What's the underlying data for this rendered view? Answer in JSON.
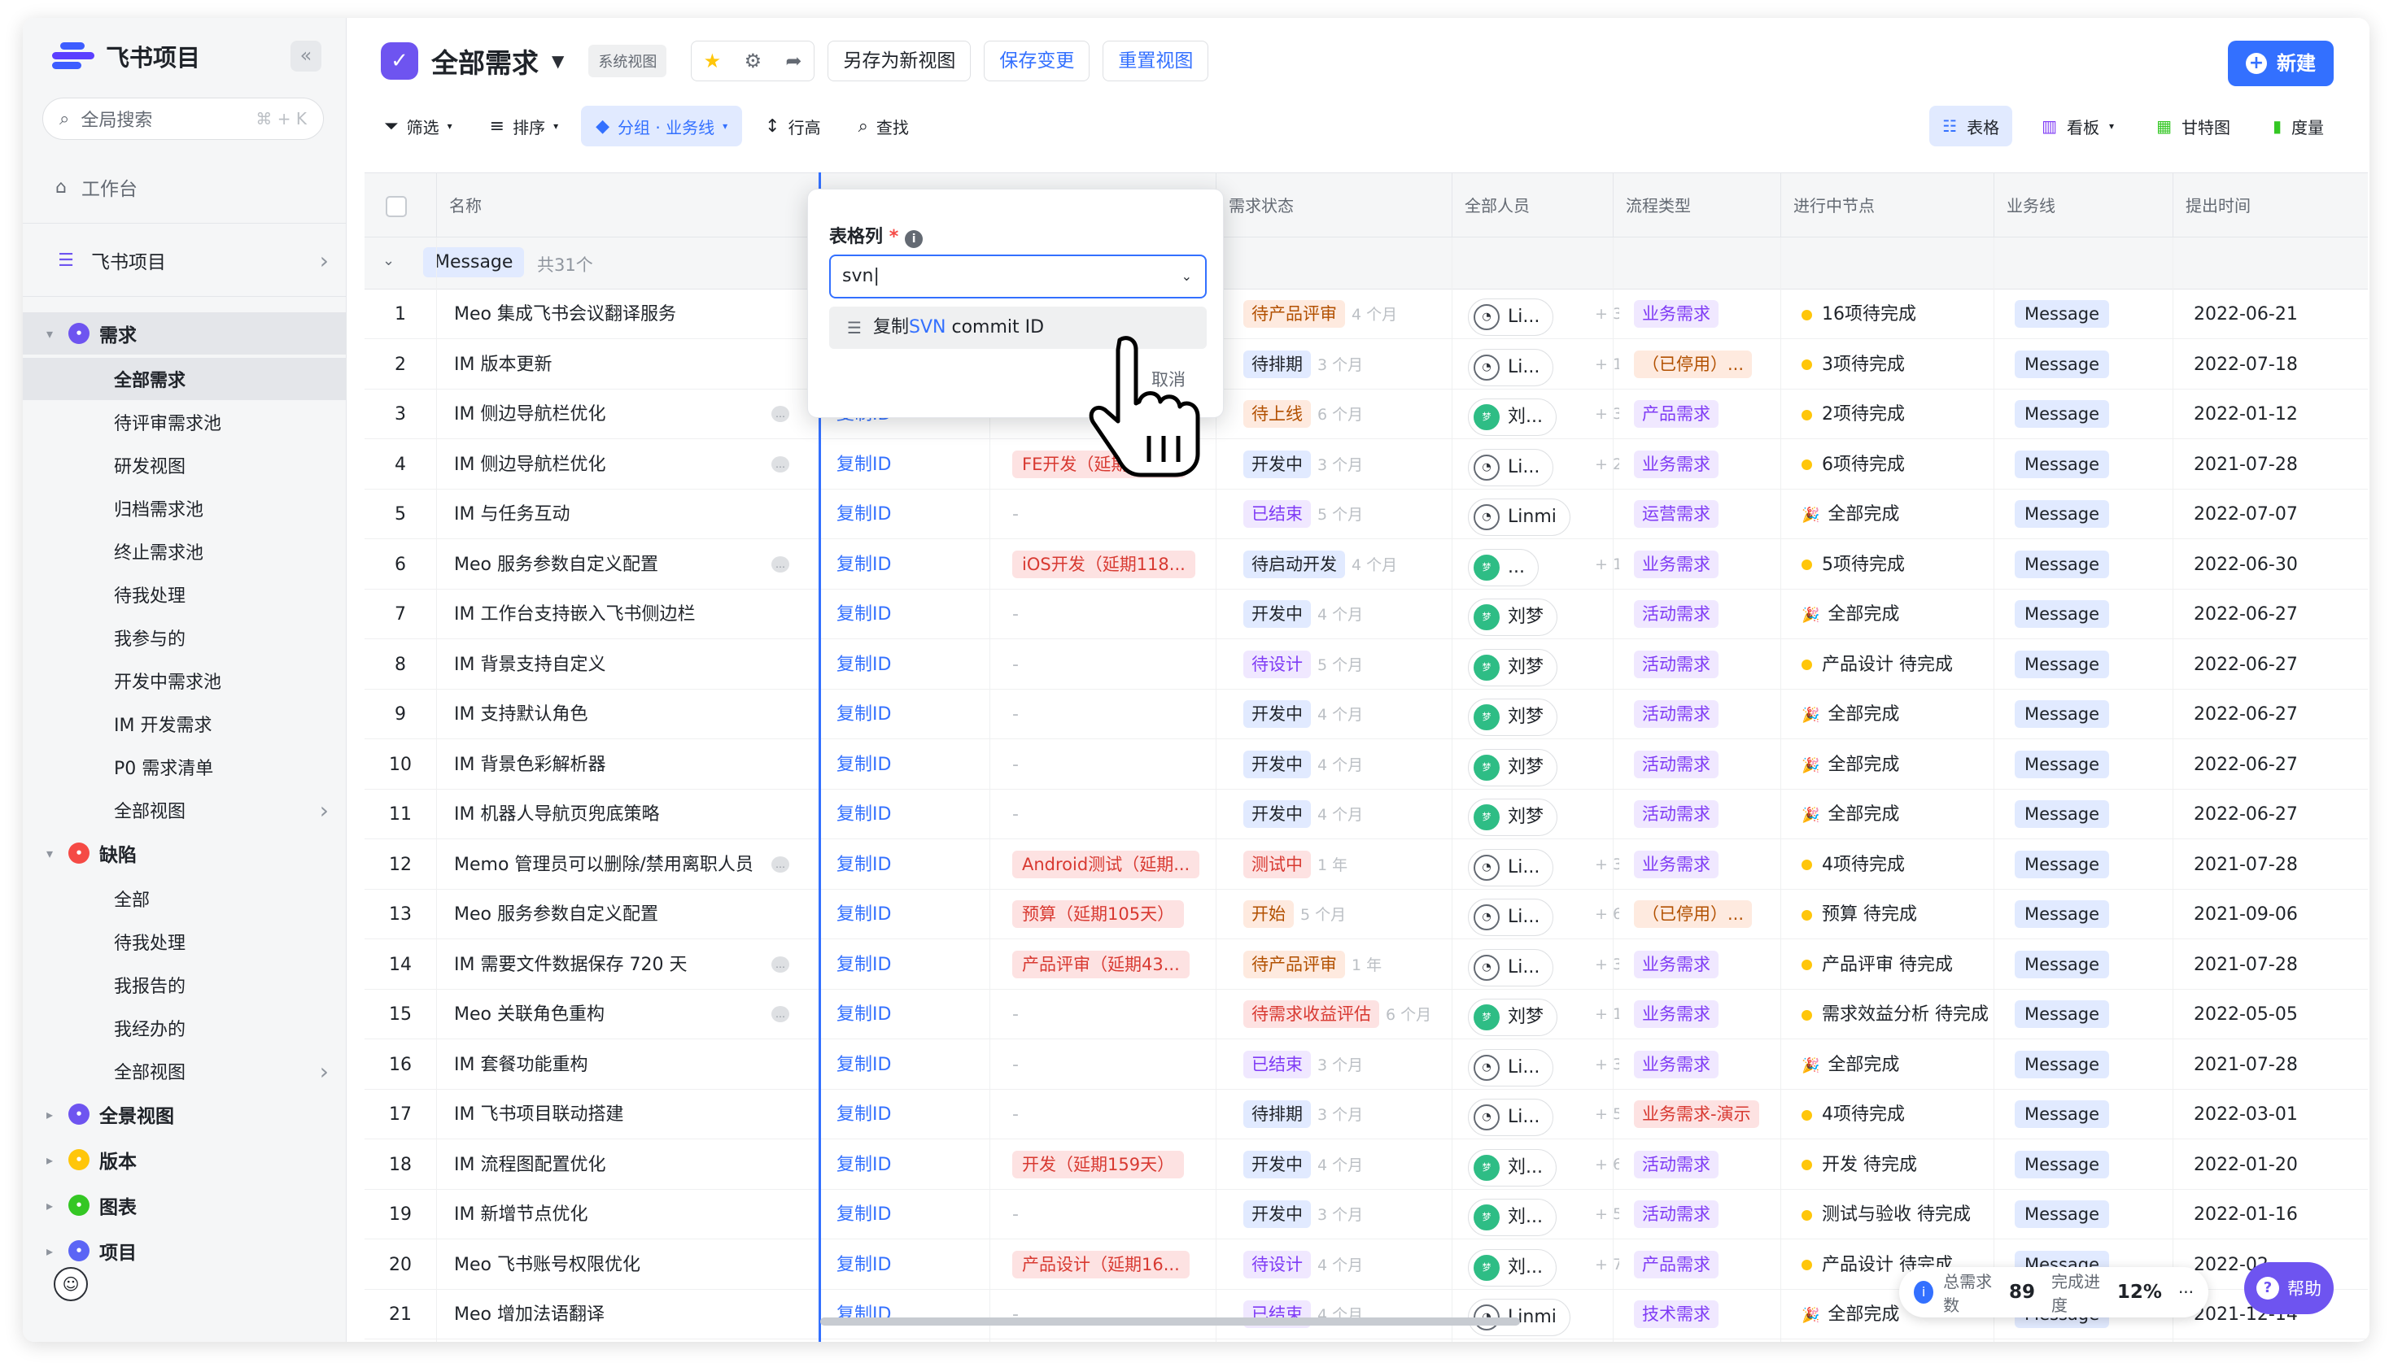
{
  "sidebar": {
    "app_name": "飞书项目",
    "search": {
      "label": "全局搜索",
      "shortcut": "⌘ + K"
    },
    "workbench": "工作台",
    "space": "飞书项目",
    "sections": [
      {
        "label": "需求",
        "color": "#6e54f0",
        "items": [
          "全部需求",
          "待评审需求池",
          "研发视图",
          "归档需求池",
          "终止需求池",
          "待我处理",
          "我参与的",
          "开发中需求池",
          "IM 开发需求",
          "P0 需求清单",
          "全部视图"
        ]
      },
      {
        "label": "缺陷",
        "color": "#f54a45",
        "items": [
          "全部",
          "待我处理",
          "我报告的",
          "我经办的",
          "全部视图"
        ]
      },
      {
        "label": "全景视图",
        "color": "#6e54f0"
      },
      {
        "label": "版本",
        "color": "#ffc60a"
      },
      {
        "label": "图表",
        "color": "#34c724"
      },
      {
        "label": "项目",
        "color": "#5b65f5"
      }
    ]
  },
  "header": {
    "title": "全部需求",
    "system_view": "系统视图",
    "save_as": "另存为新视图",
    "save_changes": "保存变更",
    "reset_view": "重置视图",
    "new_label": "新建"
  },
  "toolbar": {
    "filter": "筛选",
    "sort": "排序",
    "group": "分组 · 业务线",
    "row_height": "行高",
    "find": "查找"
  },
  "views": {
    "table": "表格",
    "kanban": "看板",
    "gantt": "甘特图",
    "metrics": "度量"
  },
  "columns": {
    "name": "名称",
    "status": "需求状态",
    "people": "全部人员",
    "flow": "流程类型",
    "node": "进行中节点",
    "biz": "业务线",
    "date": "提出时间"
  },
  "group": {
    "label": "Message",
    "count": "共31个"
  },
  "rows": [
    {
      "i": "1",
      "name": "Meo 集成飞书会议翻译服务",
      "copy": "",
      "blk": "",
      "status": "待产品评审",
      "ago": "4 个月",
      "person": "Li...",
      "more": "+ 3",
      "flow": "业务需求",
      "node": "16项待完成",
      "biz": "Message",
      "date": "2022-06-21"
    },
    {
      "i": "2",
      "name": "IM 版本更新",
      "copy": "",
      "blk": "",
      "status": "待排期",
      "ago": "3 个月",
      "person": "Li...",
      "more": "+ 1",
      "flow": "（已停用）...",
      "node": "3项待完成",
      "biz": "Message",
      "date": "2022-07-18"
    },
    {
      "i": "3",
      "name": "IM 侧边导航栏优化",
      "copy": "复制ID",
      "blk": "-",
      "status": "待上线",
      "ago": "6 个月",
      "person": "刘...",
      "more": "+ 3",
      "flow": "产品需求",
      "node": "2项待完成",
      "biz": "Message",
      "date": "2022-01-12"
    },
    {
      "i": "4",
      "name": "IM 侧边导航栏优化",
      "copy": "复制ID",
      "blk": "FE开发（延期496...",
      "status": "开发中",
      "ago": "3 个月",
      "person": "Li...",
      "more": "+ 2",
      "flow": "业务需求",
      "node": "6项待完成",
      "biz": "Message",
      "date": "2021-07-28"
    },
    {
      "i": "5",
      "name": "IM 与任务互动",
      "copy": "复制ID",
      "blk": "-",
      "status": "已结束",
      "ago": "5 个月",
      "person": "Linmi",
      "more": "",
      "flow": "运营需求",
      "node": "全部完成",
      "biz": "Message",
      "date": "2022-07-07"
    },
    {
      "i": "6",
      "name": "Meo 服务参数自定义配置",
      "copy": "复制ID",
      "blk": "iOS开发（延期118...",
      "status": "待启动开发",
      "ago": "4 个月",
      "person": "...",
      "more": "+ 10",
      "flow": "业务需求",
      "node": "5项待完成",
      "biz": "Message",
      "date": "2022-06-30"
    },
    {
      "i": "7",
      "name": "IM 工作台支持嵌入飞书侧边栏",
      "copy": "复制ID",
      "blk": "-",
      "status": "开发中",
      "ago": "4 个月",
      "person": "刘梦",
      "more": "",
      "flow": "活动需求",
      "node": "全部完成",
      "biz": "Message",
      "date": "2022-06-27"
    },
    {
      "i": "8",
      "name": "IM 背景支持自定义",
      "copy": "复制ID",
      "blk": "-",
      "status": "待设计",
      "ago": "5 个月",
      "person": "刘梦",
      "more": "",
      "flow": "活动需求",
      "node": "产品设计 待完成",
      "biz": "Message",
      "date": "2022-06-27"
    },
    {
      "i": "9",
      "name": "IM 支持默认角色",
      "copy": "复制ID",
      "blk": "-",
      "status": "开发中",
      "ago": "4 个月",
      "person": "刘梦",
      "more": "",
      "flow": "活动需求",
      "node": "全部完成",
      "biz": "Message",
      "date": "2022-06-27"
    },
    {
      "i": "10",
      "name": "IM 背景色彩解析器",
      "copy": "复制ID",
      "blk": "-",
      "status": "开发中",
      "ago": "4 个月",
      "person": "刘梦",
      "more": "",
      "flow": "活动需求",
      "node": "全部完成",
      "biz": "Message",
      "date": "2022-06-27"
    },
    {
      "i": "11",
      "name": "IM 机器人导航页兜底策略",
      "copy": "复制ID",
      "blk": "-",
      "status": "开发中",
      "ago": "4 个月",
      "person": "刘梦",
      "more": "",
      "flow": "活动需求",
      "node": "全部完成",
      "biz": "Message",
      "date": "2022-06-27"
    },
    {
      "i": "12",
      "name": "Memo 管理员可以删除/禁用离职人员",
      "copy": "复制ID",
      "blk": "Android测试（延期...",
      "status": "测试中",
      "ago": "1 年",
      "person": "Li...",
      "more": "+ 3",
      "flow": "业务需求",
      "node": "4项待完成",
      "biz": "Message",
      "date": "2021-07-28"
    },
    {
      "i": "13",
      "name": "Meo 服务参数自定义配置",
      "copy": "复制ID",
      "blk": "预算（延期105天）",
      "status": "开始",
      "ago": "5 个月",
      "person": "Li...",
      "more": "+ 6",
      "flow": "（已停用）...",
      "node": "预算 待完成",
      "biz": "Message",
      "date": "2021-09-06"
    },
    {
      "i": "14",
      "name": "IM 需要文件数据保存 720 天",
      "copy": "复制ID",
      "blk": "产品评审（延期43...",
      "status": "待产品评审",
      "ago": "1 年",
      "person": "Li...",
      "more": "+ 3",
      "flow": "业务需求",
      "node": "产品评审 待完成",
      "biz": "Message",
      "date": "2021-07-28"
    },
    {
      "i": "15",
      "name": "Meo 关联角色重构",
      "copy": "复制ID",
      "blk": "-",
      "status": "待需求收益评估",
      "ago": "6 个月",
      "person": "刘梦",
      "more": "+ 1",
      "flow": "业务需求",
      "node": "需求效益分析 待完成",
      "biz": "Message",
      "date": "2022-05-05"
    },
    {
      "i": "16",
      "name": "IM 套餐功能重构",
      "copy": "复制ID",
      "blk": "-",
      "status": "已结束",
      "ago": "3 个月",
      "person": "Li...",
      "more": "+ 3",
      "flow": "业务需求",
      "node": "全部完成",
      "biz": "Message",
      "date": "2021-07-28"
    },
    {
      "i": "17",
      "name": "IM 飞书项目联动搭建",
      "copy": "复制ID",
      "blk": "-",
      "status": "待排期",
      "ago": "3 个月",
      "person": "Li...",
      "more": "+ 5",
      "flow": "业务需求-演示",
      "node": "4项待完成",
      "biz": "Message",
      "date": "2022-03-01"
    },
    {
      "i": "18",
      "name": "IM 流程图配置优化",
      "copy": "复制ID",
      "blk": "开发（延期159天）",
      "status": "开发中",
      "ago": "4 个月",
      "person": "刘...",
      "more": "+ 6",
      "flow": "活动需求",
      "node": "开发 待完成",
      "biz": "Message",
      "date": "2022-01-20"
    },
    {
      "i": "19",
      "name": "IM 新增节点优化",
      "copy": "复制ID",
      "blk": "-",
      "status": "开发中",
      "ago": "3 个月",
      "person": "刘...",
      "more": "+ 5",
      "flow": "活动需求",
      "node": "测试与验收 待完成",
      "biz": "Message",
      "date": "2022-01-16"
    },
    {
      "i": "20",
      "name": "Meo 飞书账号权限优化",
      "copy": "复制ID",
      "blk": "产品设计（延期16...",
      "status": "待设计",
      "ago": "4 个月",
      "person": "刘...",
      "more": "+ 7",
      "flow": "产品需求",
      "node": "产品设计 待完成",
      "biz": "Message",
      "date": "2022-02-..."
    },
    {
      "i": "21",
      "name": "Meo 增加法语翻译",
      "copy": "复制ID",
      "blk": "-",
      "status": "已结束",
      "ago": "4 个月",
      "person": "Linmi",
      "more": "",
      "flow": "技术需求",
      "node": "全部完成",
      "biz": "Message",
      "date": "2021-12-14"
    }
  ],
  "popover": {
    "label": "表格列",
    "required": "*",
    "input_value": "svn",
    "option_prefix": "复制",
    "option_match": "SVN",
    "option_suffix": " commit ID",
    "cancel": "取消"
  },
  "footer": {
    "total_label": "总需求数",
    "total": "89",
    "progress_label": "完成进度",
    "progress": "12%",
    "help": "帮助"
  }
}
